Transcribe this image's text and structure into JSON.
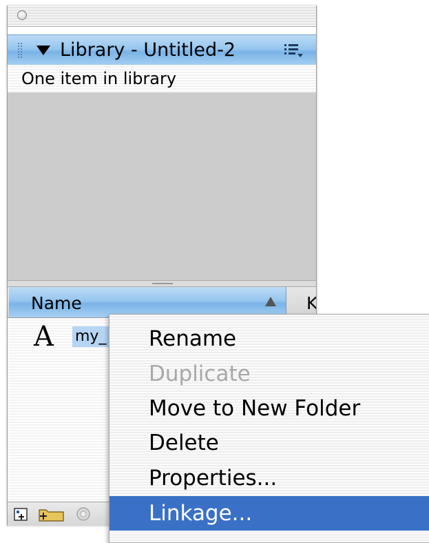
{
  "panel": {
    "header": {
      "title": "Library - Untitled-2"
    },
    "item_count": "One item in library",
    "columns": {
      "name": "Name",
      "kind_partial": "K"
    },
    "items": [
      {
        "icon": "font-symbol-icon",
        "glyph": "A",
        "name": "my_"
      }
    ]
  },
  "context_menu": {
    "items": [
      {
        "label": "Rename",
        "state": "enabled"
      },
      {
        "label": "Duplicate",
        "state": "disabled"
      },
      {
        "label": "Move to New Folder",
        "state": "enabled"
      },
      {
        "label": "Delete",
        "state": "enabled"
      },
      {
        "label": "Properties...",
        "state": "enabled"
      },
      {
        "label": "Linkage...",
        "state": "selected"
      }
    ]
  },
  "colors": {
    "header_blue": "#96c6ee",
    "selection_blue": "#3a71c6",
    "preview_gray": "#cccccc",
    "disabled_text": "#a8a8a8"
  }
}
